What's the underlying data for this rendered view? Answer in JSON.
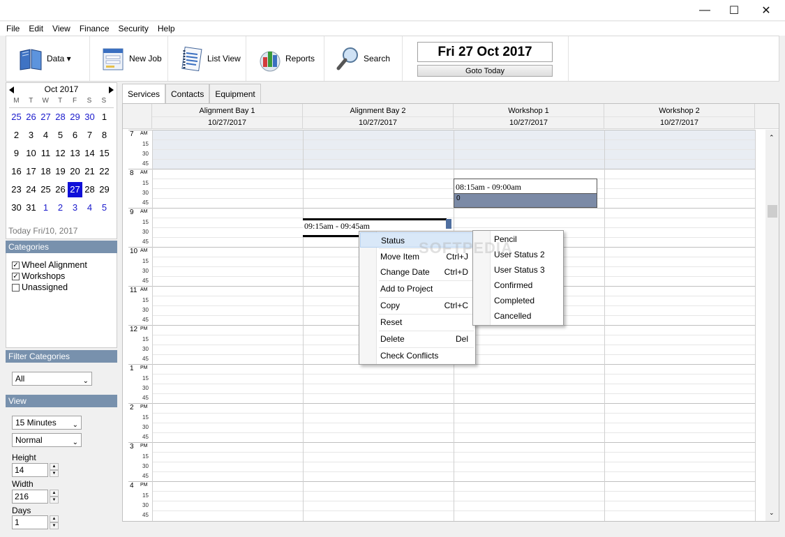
{
  "window": {
    "controls": [
      "—",
      "☐",
      "✕"
    ]
  },
  "menu": [
    "File",
    "Edit",
    "View",
    "Finance",
    "Security",
    "Help"
  ],
  "toolbar": {
    "buttons": [
      {
        "label": "Data ▾",
        "icon": "book-icon"
      },
      {
        "label": "New Job",
        "icon": "form-icon"
      },
      {
        "label": "List View",
        "icon": "notebook-icon"
      },
      {
        "label": "Reports",
        "icon": "reports-icon"
      },
      {
        "label": "Search",
        "icon": "magnifier-icon"
      }
    ],
    "current_date": "Fri 27 Oct 2017",
    "goto_today": "Goto Today"
  },
  "calendar": {
    "month": "Oct 2017",
    "weekdays": [
      "M",
      "T",
      "W",
      "T",
      "F",
      "S",
      "S"
    ],
    "weeks": [
      [
        "25",
        "26",
        "27",
        "28",
        "29",
        "30",
        "1"
      ],
      [
        "2",
        "3",
        "4",
        "5",
        "6",
        "7",
        "8"
      ],
      [
        "9",
        "10",
        "11",
        "12",
        "13",
        "14",
        "15"
      ],
      [
        "16",
        "17",
        "18",
        "19",
        "20",
        "21",
        "22"
      ],
      [
        "23",
        "24",
        "25",
        "26",
        "27",
        "28",
        "29"
      ],
      [
        "30",
        "31",
        "1",
        "2",
        "3",
        "4",
        "5"
      ]
    ],
    "selected": "27",
    "today": "Today Fri/10, 2017"
  },
  "categories": {
    "title": "Categories",
    "items": [
      {
        "label": "Wheel Alignment",
        "checked": true
      },
      {
        "label": "Workshops",
        "checked": true
      },
      {
        "label": "Unassigned",
        "checked": false
      }
    ]
  },
  "filter": {
    "title": "Filter Categories",
    "value": "All"
  },
  "view": {
    "title": "View",
    "interval": "15 Minutes",
    "mode": "Normal",
    "height_label": "Height",
    "height": "14",
    "width_label": "Width",
    "width": "216",
    "days_label": "Days",
    "days": "1"
  },
  "tabs": [
    "Services",
    "Contacts",
    "Equipment"
  ],
  "columns": [
    {
      "name": "Alignment Bay 1",
      "date": "10/27/2017"
    },
    {
      "name": "Alignment Bay 2",
      "date": "10/27/2017"
    },
    {
      "name": "Workshop 1",
      "date": "10/27/2017"
    },
    {
      "name": "Workshop 2",
      "date": "10/27/2017"
    }
  ],
  "hours": [
    {
      "h": "7",
      "p": "AM"
    },
    {
      "h": "8",
      "p": "AM"
    },
    {
      "h": "9",
      "p": "AM"
    },
    {
      "h": "10",
      "p": "AM"
    },
    {
      "h": "11",
      "p": "AM"
    },
    {
      "h": "12",
      "p": "PM"
    },
    {
      "h": "1",
      "p": "PM"
    },
    {
      "h": "2",
      "p": "PM"
    },
    {
      "h": "3",
      "p": "PM"
    },
    {
      "h": "4",
      "p": "PM"
    }
  ],
  "quarters": [
    "15",
    "30",
    "45"
  ],
  "appointments": [
    {
      "time": "08:15am - 09:00am",
      "note": "0"
    },
    {
      "time": "09:15am - 09:45am"
    }
  ],
  "context_menu": [
    {
      "label": "Status",
      "key": ""
    },
    {
      "label": "Move Item",
      "key": "Ctrl+J"
    },
    {
      "label": "Change Date",
      "key": "Ctrl+D"
    },
    {
      "label": "Add to Project",
      "key": ""
    },
    {
      "label": "Copy",
      "key": "Ctrl+C"
    },
    {
      "label": "Reset",
      "key": ""
    },
    {
      "label": "Delete",
      "key": "Del"
    },
    {
      "label": "Check Conflicts",
      "key": ""
    }
  ],
  "status_submenu": [
    "Pencil",
    "User Status 2",
    "User Status 3",
    "Confirmed",
    "Completed",
    "Cancelled"
  ],
  "watermark": "SOFTPEDIA"
}
